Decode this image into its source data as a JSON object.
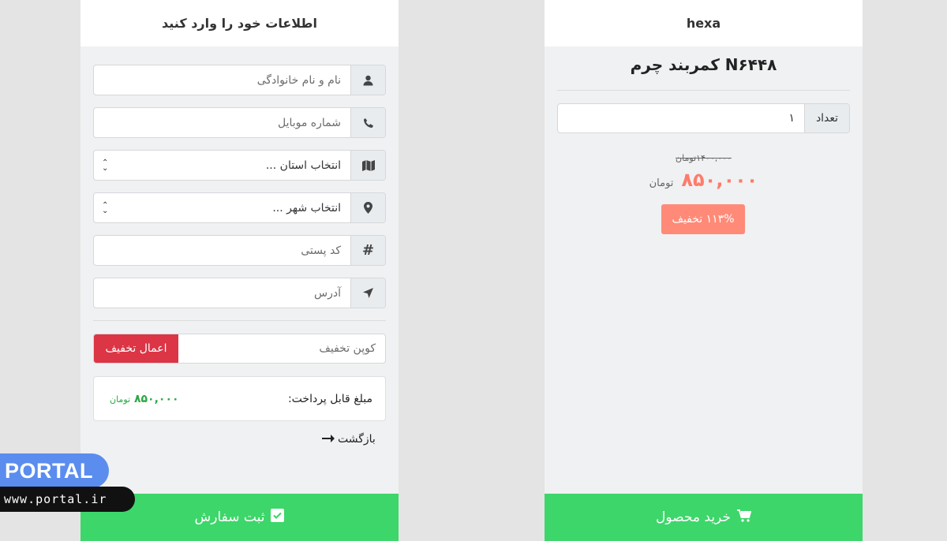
{
  "left_panel": {
    "title": "اطلاعات خود را وارد کنید",
    "fields": [
      {
        "icon": "user-icon",
        "placeholder": "نام و نام خانوادگی"
      },
      {
        "icon": "phone-icon",
        "placeholder": "شماره موبایل"
      },
      {
        "icon": "map-icon",
        "value": "انتخاب استان ..."
      },
      {
        "icon": "location-pin-icon",
        "value": "انتخاب شهر ..."
      },
      {
        "icon": "hash-icon",
        "placeholder": "کد پستی"
      },
      {
        "icon": "location-arrow-icon",
        "placeholder": "آدرس"
      }
    ],
    "coupon": {
      "placeholder": "کوپن تخفیف",
      "button_label": "اعمال تخفیف"
    },
    "total": {
      "label": "مبلغ قابل پرداخت:",
      "amount": "۸۵۰,۰۰۰",
      "unit": "تومان"
    },
    "back_label": "بازگشت",
    "submit_label": "ثبت سفارش"
  },
  "right_panel": {
    "brand": "hexa",
    "product_title": "کمربند چرم N۶۴۴۸",
    "quantity_label": "تعداد",
    "quantity_value": "۱",
    "old_price": "۱۴۰۰,۰۰۰",
    "old_price_unit": "تومان",
    "price": "۸۵۰,۰۰۰",
    "price_unit": "تومان",
    "discount_label": "۱۱۳% تخفیف",
    "buy_label": "خرید محصول"
  },
  "watermark": {
    "name": "PORTAL",
    "url": "www.portal.ir"
  },
  "colors": {
    "green": "#3dd66a",
    "red": "#dc3545",
    "salmon": "#ff8a78",
    "price": "#ff7b6b"
  }
}
